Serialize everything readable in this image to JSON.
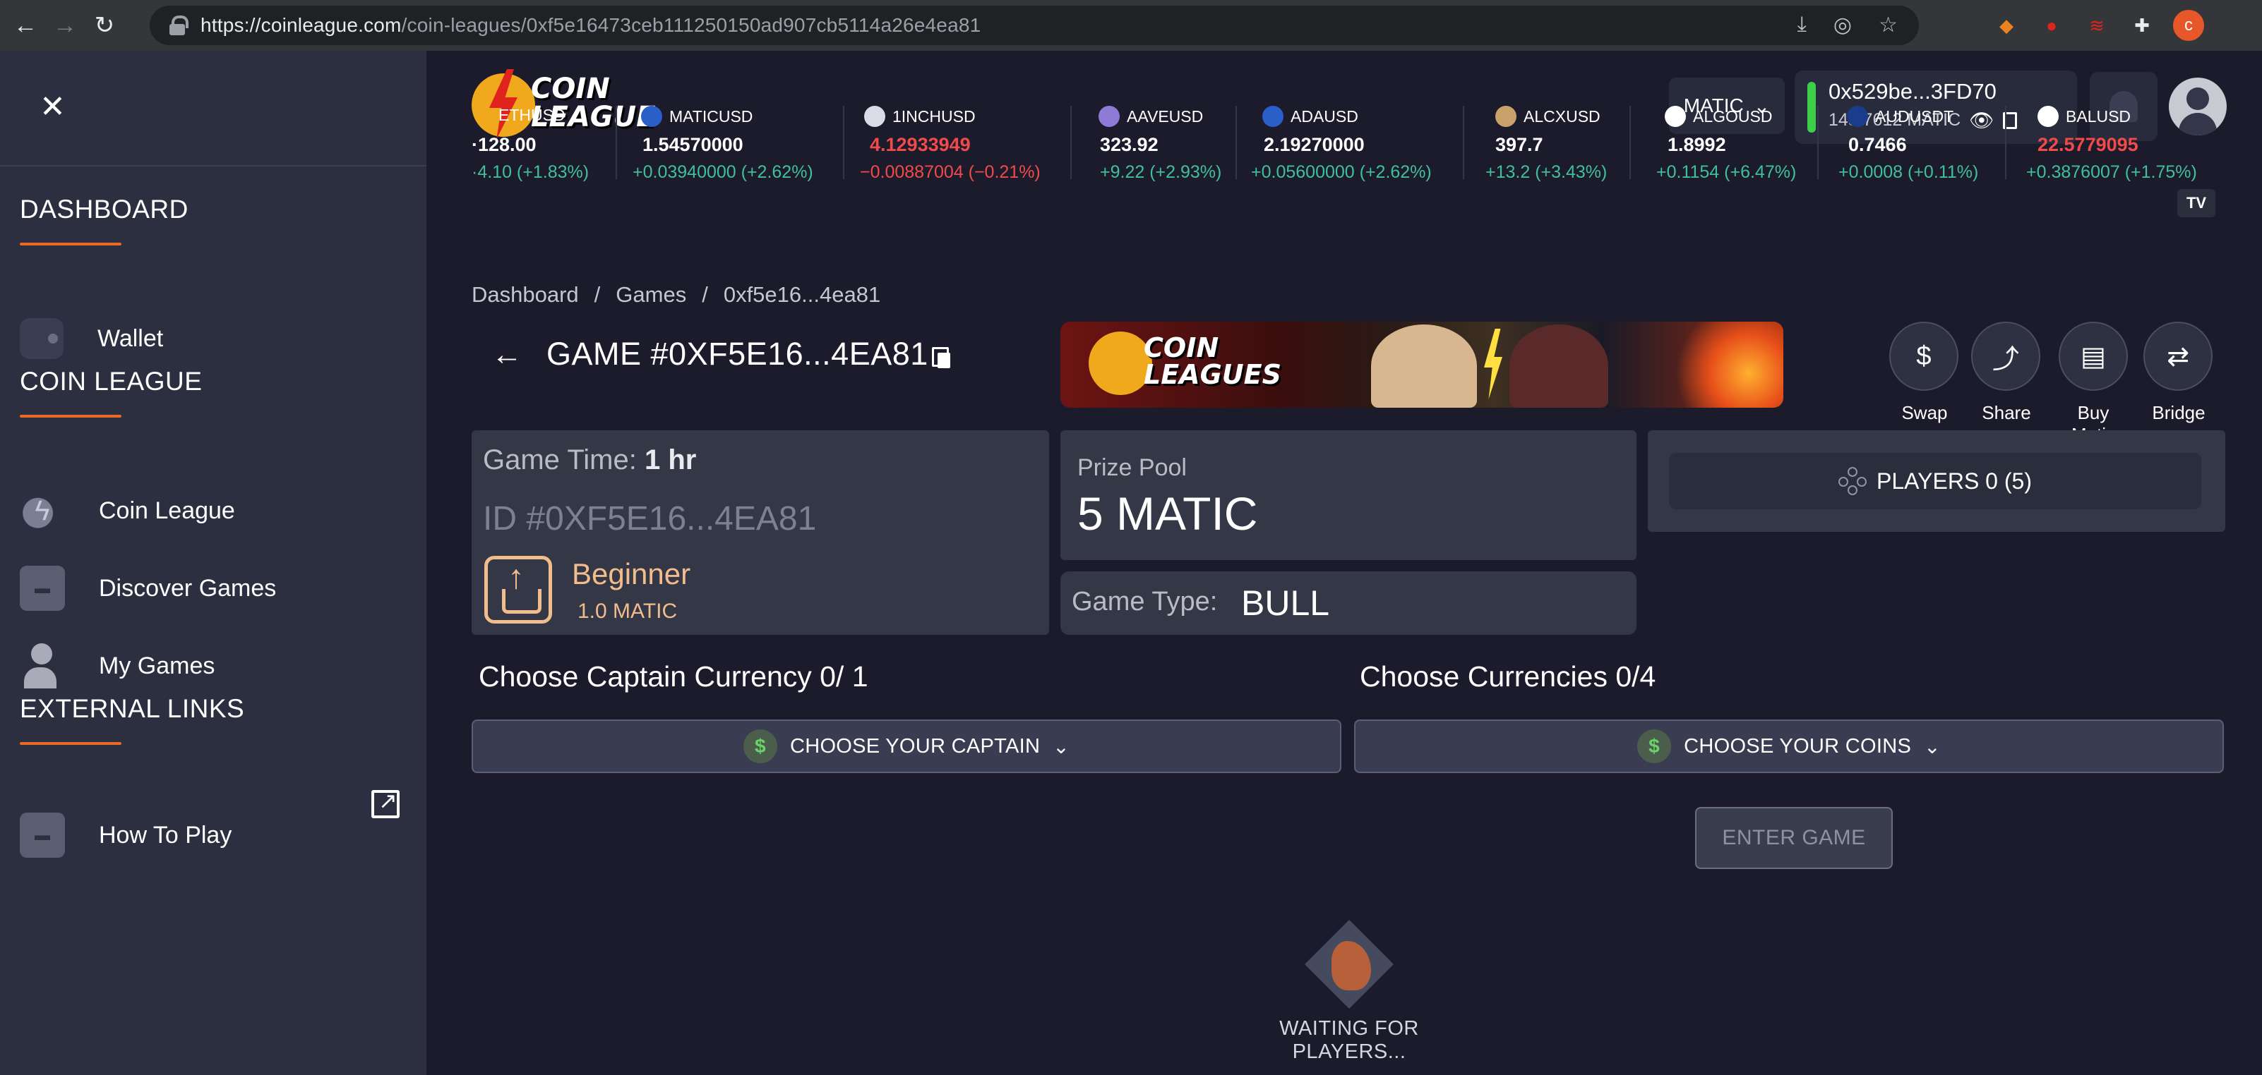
{
  "browser": {
    "url_host": "https://coinleague.com",
    "url_path": "/coin-leagues/0xf5e16473ceb111250150ad907cb5114a26e4ea81",
    "profile_initial": "c"
  },
  "sidebar": {
    "sections": [
      {
        "title": "DASHBOARD",
        "items": [
          {
            "label": "Wallet",
            "icon": "wallet-icon"
          }
        ]
      },
      {
        "title": "COIN LEAGUE",
        "items": [
          {
            "label": "Coin League",
            "icon": "coin-league-icon"
          },
          {
            "label": "Discover Games",
            "icon": "discover-games-icon"
          },
          {
            "label": "My Games",
            "icon": "my-games-icon"
          }
        ]
      },
      {
        "title": "EXTERNAL LINKS",
        "items": [
          {
            "label": "How To Play",
            "icon": "how-to-play-icon"
          }
        ]
      }
    ]
  },
  "header": {
    "logo_line1": "COIN",
    "logo_line2": "LEAGUE",
    "network": "MATIC",
    "wallet_address": "0x529be...3FD70",
    "wallet_balance": "148.7612 MATIC",
    "status_color": "#3ecf4a"
  },
  "ticker": [
    {
      "symbol": "ETHUSD",
      "price": "·128.00",
      "change": "·4.10 (+1.83%)",
      "dir": "pos"
    },
    {
      "symbol": "MATICUSD",
      "price": "1.54570000",
      "change": "+0.03940000 (+2.62%)",
      "dir": "pos"
    },
    {
      "symbol": "1INCHUSD",
      "price": "4.12933949",
      "change": "−0.00887004 (−0.21%)",
      "dir": "neg"
    },
    {
      "symbol": "AAVEUSD",
      "price": "323.92",
      "change": "+9.22 (+2.93%)",
      "dir": "pos"
    },
    {
      "symbol": "ADAUSD",
      "price": "2.19270000",
      "change": "+0.05600000 (+2.62%)",
      "dir": "pos"
    },
    {
      "symbol": "ALCXUSD",
      "price": "397.7",
      "change": "+13.2 (+3.43%)",
      "dir": "pos"
    },
    {
      "symbol": "ALGOUSD",
      "price": "1.8992",
      "change": "+0.1154 (+6.47%)",
      "dir": "pos"
    },
    {
      "symbol": "AUDUSDT",
      "price": "0.7466",
      "change": "+0.0008 (+0.11%)",
      "dir": "pos"
    },
    {
      "symbol": "BALUSD",
      "price": "22.5779095",
      "change": "+0.3876007 (+1.75%)",
      "dir": "neg"
    }
  ],
  "tradingview_label": "TV",
  "breadcrumb": {
    "items": [
      "Dashboard",
      "Games",
      "0xf5e16...4ea81"
    ],
    "sep": "/"
  },
  "game": {
    "title": "GAME #0XF5E16...4EA81",
    "banner_line1": "COIN",
    "banner_line2": "LEAGUES",
    "time_label": "Game Time: ",
    "time_value": "1 hr",
    "id": "ID #0XF5E16...4EA81",
    "level": "Beginner",
    "level_amount": "1.0 MATIC",
    "prize_label": "Prize Pool",
    "prize_value": "5 MATIC",
    "type_label": "Game Type:",
    "type_value": "BULL",
    "players": "PLAYERS 0 (5)"
  },
  "actions": [
    {
      "label": "Swap",
      "icon": "swap-icon",
      "glyph": "$"
    },
    {
      "label": "Share",
      "icon": "share-icon",
      "glyph": "⤴"
    },
    {
      "label": "Buy Matic",
      "icon": "buy-matic-icon",
      "glyph": "▤"
    },
    {
      "label": "Bridge",
      "icon": "bridge-icon",
      "glyph": "⇄"
    }
  ],
  "choose": {
    "captain_title": "Choose Captain Currency 0/ 1",
    "captain_button": "CHOOSE YOUR CAPTAIN",
    "coins_title": "Choose Currencies 0/4",
    "coins_button": "CHOOSE YOUR COINS",
    "dollar": "$"
  },
  "enter_button": "ENTER GAME",
  "waiting": "WAITING FOR PLAYERS..."
}
